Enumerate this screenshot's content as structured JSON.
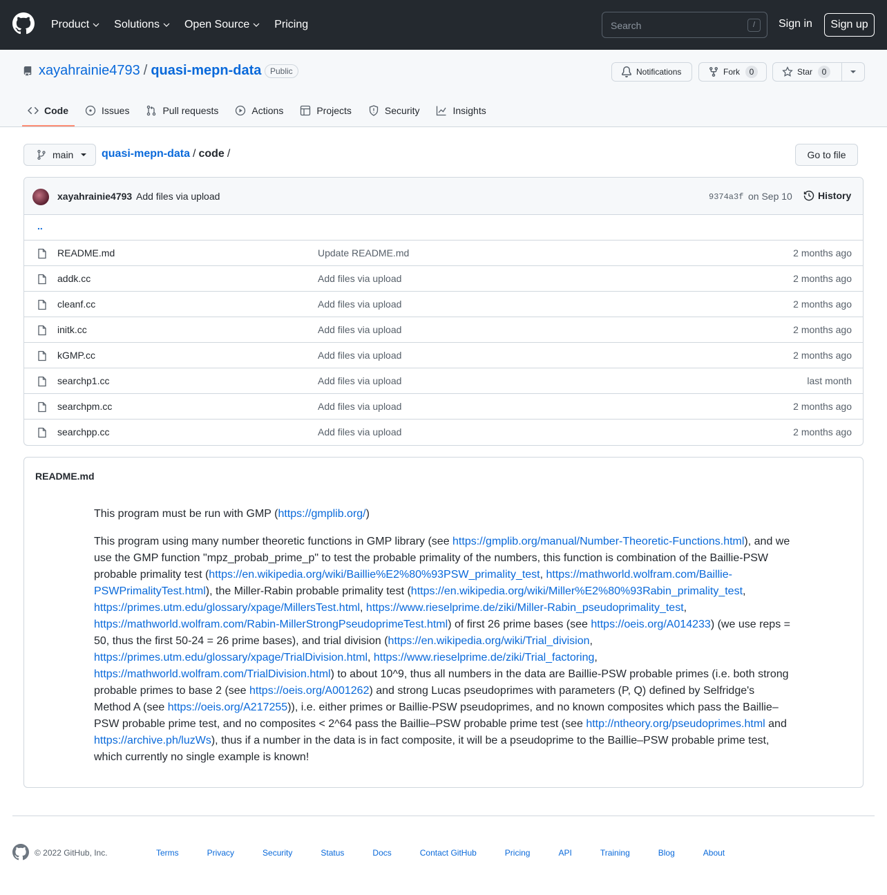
{
  "header": {
    "nav": [
      "Product",
      "Solutions",
      "Open Source",
      "Pricing"
    ],
    "search_placeholder": "Search",
    "search_shortcut": "/",
    "sign_in": "Sign in",
    "sign_up": "Sign up"
  },
  "repo": {
    "owner": "xayahrainie4793",
    "separator": "/",
    "name": "quasi-mepn-data",
    "visibility": "Public",
    "notifications_label": "Notifications",
    "fork_label": "Fork",
    "fork_count": "0",
    "star_label": "Star",
    "star_count": "0",
    "tabs": [
      "Code",
      "Issues",
      "Pull requests",
      "Actions",
      "Projects",
      "Security",
      "Insights"
    ]
  },
  "breadcrumb": {
    "branch": "main",
    "repo": "quasi-mepn-data",
    "sep": "/",
    "dir": "code",
    "goto_file": "Go to file"
  },
  "commit": {
    "author": "xayahrainie4793",
    "message": "Add files via upload",
    "sha": "9374a3f",
    "date": "on Sep 10",
    "history": "History"
  },
  "parent_dir": "..",
  "files": [
    {
      "name": "README.md",
      "message": "Update README.md",
      "age": "2 months ago"
    },
    {
      "name": "addk.cc",
      "message": "Add files via upload",
      "age": "2 months ago"
    },
    {
      "name": "cleanf.cc",
      "message": "Add files via upload",
      "age": "2 months ago"
    },
    {
      "name": "initk.cc",
      "message": "Add files via upload",
      "age": "2 months ago"
    },
    {
      "name": "kGMP.cc",
      "message": "Add files via upload",
      "age": "2 months ago"
    },
    {
      "name": "searchp1.cc",
      "message": "Add files via upload",
      "age": "last month"
    },
    {
      "name": "searchpm.cc",
      "message": "Add files via upload",
      "age": "2 months ago"
    },
    {
      "name": "searchpp.cc",
      "message": "Add files via upload",
      "age": "2 months ago"
    }
  ],
  "readme": {
    "title": "README.md",
    "paragraphs": [
      [
        {
          "t": "This program must be run with GMP ("
        },
        {
          "l": "https://gmplib.org/"
        },
        {
          "t": ")"
        }
      ],
      [
        {
          "t": "This program using many number theoretic functions in GMP library (see "
        },
        {
          "l": "https://gmplib.org/manual/Number-Theoretic-Functions.html"
        },
        {
          "t": "), and we use the GMP function \"mpz_probab_prime_p\" to test the probable primality of the numbers, this function is combination of the Baillie-PSW probable primality test ("
        },
        {
          "l": "https://en.wikipedia.org/wiki/Baillie%E2%80%93PSW_primality_test"
        },
        {
          "t": ", "
        },
        {
          "l": "https://mathworld.wolfram.com/Baillie-PSWPrimalityTest.html"
        },
        {
          "t": "), the Miller-Rabin probable primality test ("
        },
        {
          "l": "https://en.wikipedia.org/wiki/Miller%E2%80%93Rabin_primality_test"
        },
        {
          "t": ", "
        },
        {
          "l": "https://primes.utm.edu/glossary/xpage/MillersTest.html"
        },
        {
          "t": ", "
        },
        {
          "l": "https://www.rieselprime.de/ziki/Miller-Rabin_pseudoprimality_test"
        },
        {
          "t": ", "
        },
        {
          "l": "https://mathworld.wolfram.com/Rabin-MillerStrongPseudoprimeTest.html"
        },
        {
          "t": ") of first 26 prime bases (see "
        },
        {
          "l": "https://oeis.org/A014233"
        },
        {
          "t": ") (we use reps = 50, thus the first 50-24 = 26 prime bases), and trial division ("
        },
        {
          "l": "https://en.wikipedia.org/wiki/Trial_division"
        },
        {
          "t": ", "
        },
        {
          "l": "https://primes.utm.edu/glossary/xpage/TrialDivision.html"
        },
        {
          "t": ", "
        },
        {
          "l": "https://www.rieselprime.de/ziki/Trial_factoring"
        },
        {
          "t": ", "
        },
        {
          "l": "https://mathworld.wolfram.com/TrialDivision.html"
        },
        {
          "t": ") to about 10^9, thus all numbers in the data are Baillie-PSW probable primes (i.e. both strong probable primes to base 2 (see "
        },
        {
          "l": "https://oeis.org/A001262"
        },
        {
          "t": ") and strong Lucas pseudoprimes with parameters (P, Q) defined by Selfridge's Method A (see "
        },
        {
          "l": "https://oeis.org/A217255"
        },
        {
          "t": ")), i.e. either primes or Baillie-PSW pseudoprimes, and no known composites which pass the Baillie–PSW probable prime test, and no composites < 2^64 pass the Baillie–PSW probable prime test (see "
        },
        {
          "l": "http://ntheory.org/pseudoprimes.html"
        },
        {
          "t": " and "
        },
        {
          "l": "https://archive.ph/luzWs"
        },
        {
          "t": "), thus if a number in the data is in fact composite, it will be a pseudoprime to the Baillie–PSW probable prime test, which currently no single example is known!"
        }
      ]
    ]
  },
  "footer": {
    "copyright": "© 2022 GitHub, Inc.",
    "links": [
      "Terms",
      "Privacy",
      "Security",
      "Status",
      "Docs",
      "Contact GitHub",
      "Pricing",
      "API",
      "Training",
      "Blog",
      "About"
    ]
  }
}
